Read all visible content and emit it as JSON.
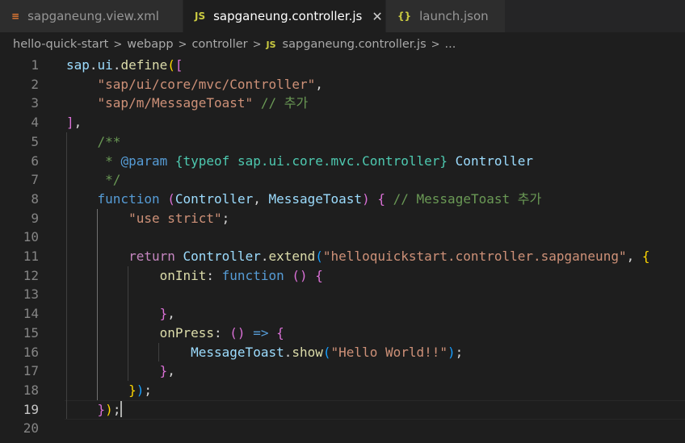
{
  "tabs": [
    {
      "label": "sapganeung.view.xml",
      "icon": "xml-file-icon",
      "active": false
    },
    {
      "label": "sapganeung.controller.js",
      "icon": "js-file-icon",
      "active": true
    },
    {
      "label": "launch.json",
      "icon": "json-file-icon",
      "active": false
    }
  ],
  "tab_icons": {
    "xml": "\\\\",
    "js": "JS",
    "json": "{}",
    "close": "✕"
  },
  "breadcrumb": [
    "hello-quick-start",
    "webapp",
    "controller",
    "sapganeung.controller.js",
    "..."
  ],
  "editor": {
    "current_line": 19,
    "line_numbers": [
      "1",
      "2",
      "3",
      "4",
      "5",
      "6",
      "7",
      "8",
      "9",
      "10",
      "11",
      "12",
      "13",
      "14",
      "15",
      "16",
      "17",
      "18",
      "19",
      "20"
    ],
    "lines": [
      [
        [
          "v",
          "sap"
        ],
        [
          "p",
          "."
        ],
        [
          "v",
          "ui"
        ],
        [
          "p",
          "."
        ],
        [
          "f",
          "define"
        ],
        [
          "b1",
          "("
        ],
        [
          "b2",
          "["
        ]
      ],
      [
        [
          "p",
          "    "
        ],
        [
          "s",
          "\"sap/ui/core/mvc/Controller\""
        ],
        [
          "p",
          ","
        ]
      ],
      [
        [
          "p",
          "    "
        ],
        [
          "s",
          "\"sap/m/MessageToast\""
        ],
        [
          "p",
          " "
        ],
        [
          "cm",
          "// 추가"
        ]
      ],
      [
        [
          "b2",
          "]"
        ],
        [
          "p",
          ","
        ]
      ],
      [
        [
          "p",
          "    "
        ],
        [
          "cm",
          "/**"
        ]
      ],
      [
        [
          "p",
          "     "
        ],
        [
          "cm",
          "* "
        ],
        [
          "k",
          "@param"
        ],
        [
          "p",
          " "
        ],
        [
          "t",
          "{typeof sap.ui.core.mvc.Controller}"
        ],
        [
          "p",
          " "
        ],
        [
          "v",
          "Controller"
        ]
      ],
      [
        [
          "p",
          "     "
        ],
        [
          "cm",
          "*/"
        ]
      ],
      [
        [
          "p",
          "    "
        ],
        [
          "k",
          "function"
        ],
        [
          "p",
          " "
        ],
        [
          "b2",
          "("
        ],
        [
          "v",
          "Controller"
        ],
        [
          "p",
          ", "
        ],
        [
          "v",
          "MessageToast"
        ],
        [
          "b2",
          ")"
        ],
        [
          "p",
          " "
        ],
        [
          "b2",
          "{"
        ],
        [
          "p",
          " "
        ],
        [
          "cm",
          "// MessageToast 추가"
        ]
      ],
      [
        [
          "p",
          "        "
        ],
        [
          "s",
          "\"use strict\""
        ],
        [
          "p",
          ";"
        ]
      ],
      [],
      [
        [
          "p",
          "        "
        ],
        [
          "c",
          "return"
        ],
        [
          "p",
          " "
        ],
        [
          "v",
          "Controller"
        ],
        [
          "p",
          "."
        ],
        [
          "f",
          "extend"
        ],
        [
          "b3",
          "("
        ],
        [
          "s",
          "\"helloquickstart.controller.sapganeung\""
        ],
        [
          "p",
          ", "
        ],
        [
          "b1",
          "{"
        ]
      ],
      [
        [
          "p",
          "            "
        ],
        [
          "f",
          "onInit"
        ],
        [
          "p",
          ": "
        ],
        [
          "k",
          "function"
        ],
        [
          "p",
          " "
        ],
        [
          "b2",
          "()"
        ],
        [
          "p",
          " "
        ],
        [
          "b2",
          "{"
        ]
      ],
      [],
      [
        [
          "p",
          "            "
        ],
        [
          "b2",
          "}"
        ],
        [
          "p",
          ","
        ]
      ],
      [
        [
          "p",
          "            "
        ],
        [
          "f",
          "onPress"
        ],
        [
          "p",
          ": "
        ],
        [
          "b2",
          "()"
        ],
        [
          "p",
          " "
        ],
        [
          "k",
          "=>"
        ],
        [
          "p",
          " "
        ],
        [
          "b2",
          "{"
        ]
      ],
      [
        [
          "p",
          "                "
        ],
        [
          "v",
          "MessageToast"
        ],
        [
          "p",
          "."
        ],
        [
          "f",
          "show"
        ],
        [
          "b3",
          "("
        ],
        [
          "s",
          "\"Hello World!!\""
        ],
        [
          "b3",
          ")"
        ],
        [
          "p",
          ";"
        ]
      ],
      [
        [
          "p",
          "            "
        ],
        [
          "b2",
          "}"
        ],
        [
          "p",
          ","
        ]
      ],
      [
        [
          "p",
          "        "
        ],
        [
          "b1",
          "}"
        ],
        [
          "b3",
          ")"
        ],
        [
          "p",
          ";"
        ]
      ],
      [
        [
          "p",
          "    "
        ],
        [
          "b2",
          "}"
        ],
        [
          "b1",
          ")"
        ],
        [
          "p",
          ";"
        ]
      ],
      []
    ]
  }
}
